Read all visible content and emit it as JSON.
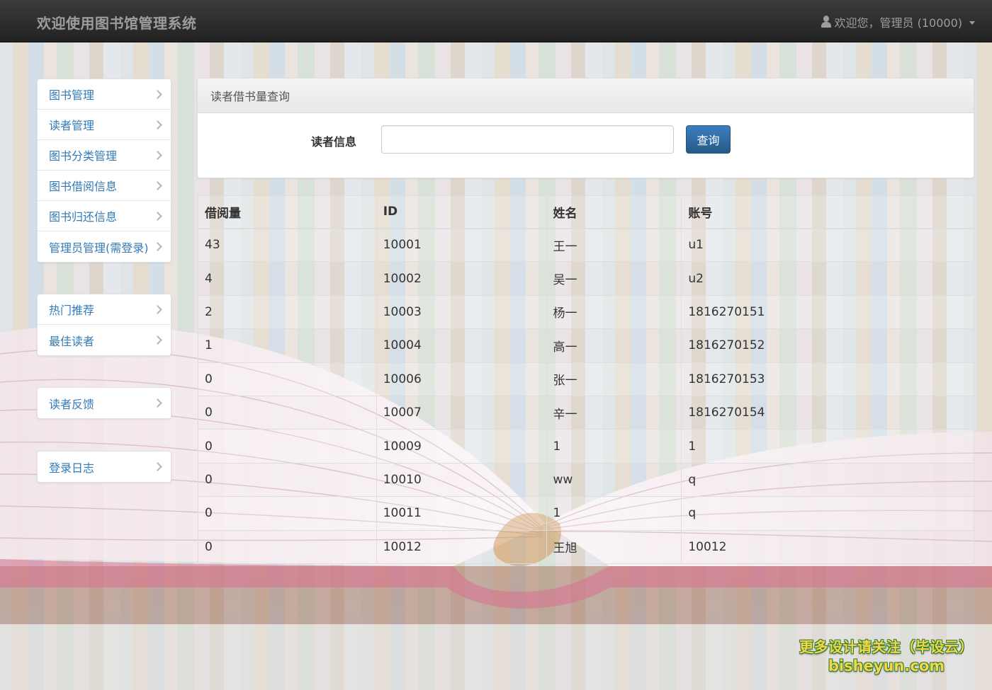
{
  "navbar": {
    "brand": "欢迎使用图书馆管理系统",
    "user_label": "欢迎您，管理员 (10000)"
  },
  "sidebar": {
    "group1": [
      {
        "label": "图书管理"
      },
      {
        "label": "读者管理"
      },
      {
        "label": "图书分类管理"
      },
      {
        "label": "图书借阅信息"
      },
      {
        "label": "图书归还信息"
      },
      {
        "label": "管理员管理(需登录)"
      }
    ],
    "group2": [
      {
        "label": "热门推荐"
      },
      {
        "label": "最佳读者"
      }
    ],
    "group3": [
      {
        "label": "读者反馈"
      }
    ],
    "group4": [
      {
        "label": "登录日志"
      }
    ]
  },
  "panel": {
    "title": "读者借书量查询",
    "field_label": "读者信息",
    "field_value": "",
    "button_label": "查询"
  },
  "table": {
    "headers": [
      "借阅量",
      "ID",
      "姓名",
      "账号"
    ],
    "rows": [
      [
        "43",
        "10001",
        "王一",
        "u1"
      ],
      [
        "4",
        "10002",
        "吴一",
        "u2"
      ],
      [
        "2",
        "10003",
        "杨一",
        "1816270151"
      ],
      [
        "1",
        "10004",
        "高一",
        "1816270152"
      ],
      [
        "0",
        "10006",
        "张一",
        "1816270153"
      ],
      [
        "0",
        "10007",
        "辛一",
        "1816270154"
      ],
      [
        "0",
        "10009",
        "1",
        "1"
      ],
      [
        "0",
        "10010",
        "ww",
        "q"
      ],
      [
        "0",
        "10011",
        "1",
        "q"
      ],
      [
        "0",
        "10012",
        "王旭",
        "10012"
      ]
    ]
  },
  "watermark": {
    "line1": "更多设计请关注（毕设云）",
    "line2": "bisheyun.com"
  },
  "icons": {
    "user": "user-icon",
    "caret": "caret-down-icon",
    "chevron": "chevron-right-icon"
  }
}
